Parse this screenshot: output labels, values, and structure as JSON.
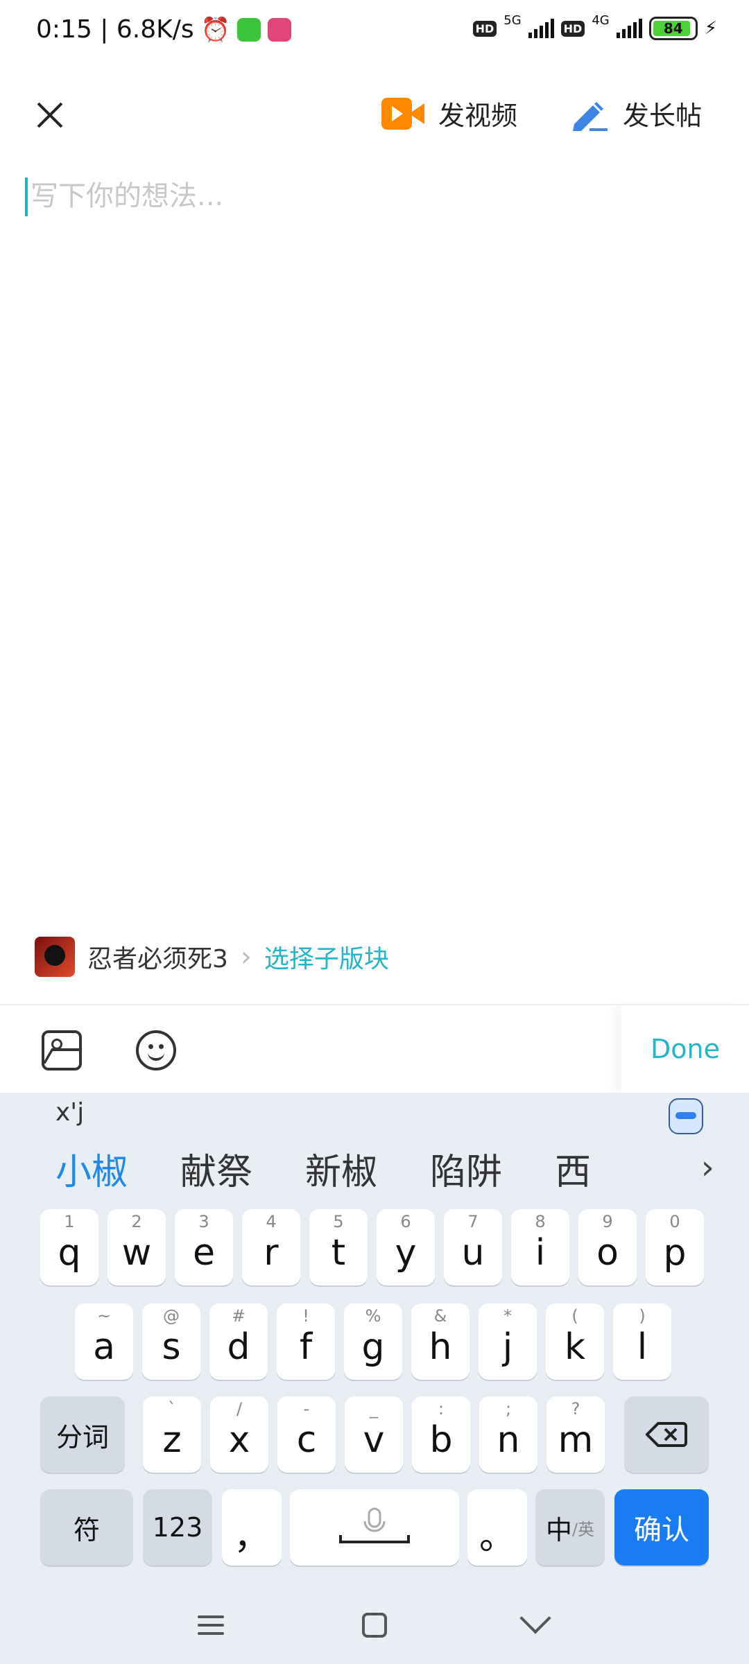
{
  "status_bar": {
    "time_speed": "0:15 | 6.8K/s",
    "hd_label": "HD",
    "net1": "5G",
    "net2": "4G",
    "battery": "84",
    "app_icon_colors": [
      "#3cc43c",
      "#e0457b"
    ]
  },
  "header": {
    "video_label": "发视频",
    "long_post_label": "发长帖"
  },
  "editor": {
    "placeholder": "写下你的想法..."
  },
  "board": {
    "name": "忍者必须死3",
    "sub_board_label": "选择子版块"
  },
  "toolbar": {
    "done_label": "Done"
  },
  "keyboard": {
    "composition": "x'j",
    "candidates": [
      "小椒",
      "献祭",
      "新椒",
      "陷阱",
      "西"
    ],
    "row1": [
      {
        "k": "q",
        "s": "1"
      },
      {
        "k": "w",
        "s": "2"
      },
      {
        "k": "e",
        "s": "3"
      },
      {
        "k": "r",
        "s": "4"
      },
      {
        "k": "t",
        "s": "5"
      },
      {
        "k": "y",
        "s": "6"
      },
      {
        "k": "u",
        "s": "7"
      },
      {
        "k": "i",
        "s": "8"
      },
      {
        "k": "o",
        "s": "9"
      },
      {
        "k": "p",
        "s": "0"
      }
    ],
    "row2": [
      {
        "k": "a",
        "s": "~"
      },
      {
        "k": "s",
        "s": "@"
      },
      {
        "k": "d",
        "s": "#"
      },
      {
        "k": "f",
        "s": "!"
      },
      {
        "k": "g",
        "s": "%"
      },
      {
        "k": "h",
        "s": "&"
      },
      {
        "k": "j",
        "s": "*"
      },
      {
        "k": "k",
        "s": "("
      },
      {
        "k": "l",
        "s": ")"
      }
    ],
    "row3": [
      {
        "k": "z",
        "s": "`"
      },
      {
        "k": "x",
        "s": "/"
      },
      {
        "k": "c",
        "s": "-"
      },
      {
        "k": "v",
        "s": "_"
      },
      {
        "k": "b",
        "s": ":"
      },
      {
        "k": "n",
        "s": ";"
      },
      {
        "k": "m",
        "s": "?"
      }
    ],
    "segment_label": "分词",
    "symbol_label": "符",
    "num_label": "123",
    "comma": "，",
    "period": "。",
    "lang_main": "中",
    "lang_sub": "/英",
    "confirm_label": "确认"
  }
}
